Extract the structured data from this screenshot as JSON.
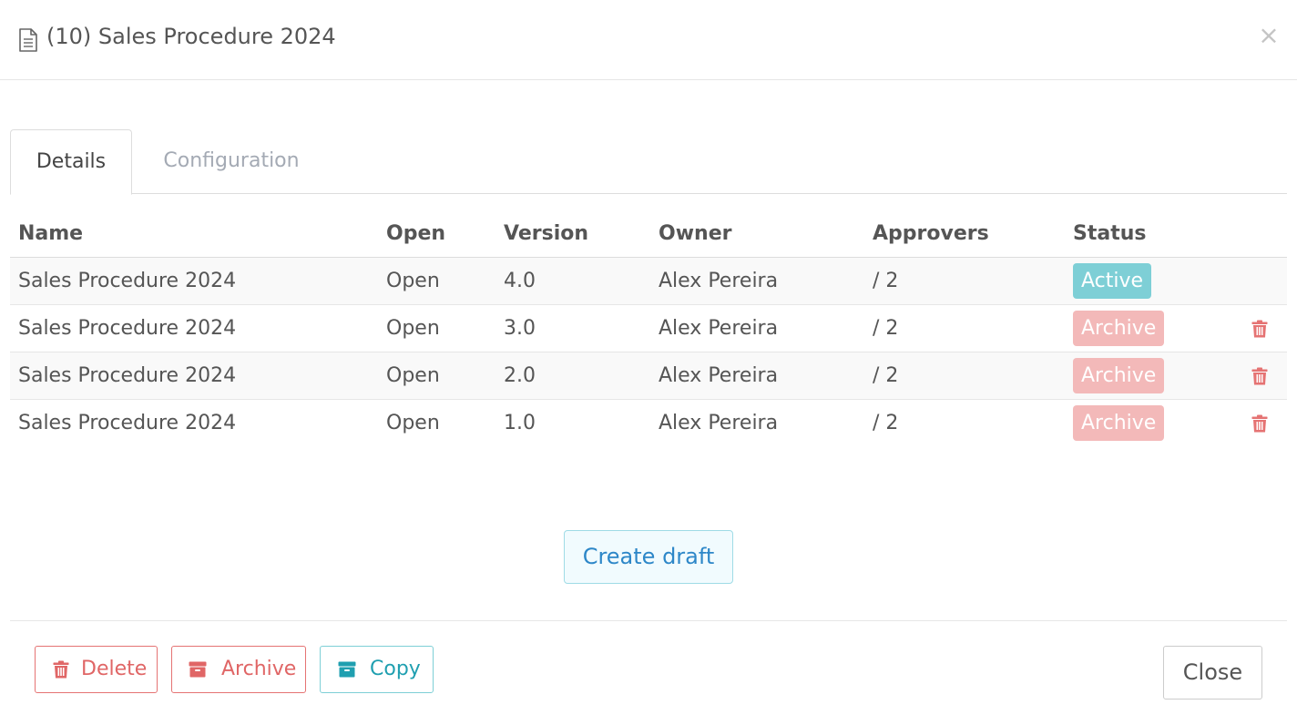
{
  "modal": {
    "title": "(10) Sales Procedure 2024",
    "close_symbol": "×"
  },
  "tabs": [
    {
      "label": "Details",
      "active": true
    },
    {
      "label": "Configuration",
      "active": false
    }
  ],
  "table": {
    "columns": [
      "Name",
      "Open",
      "Version",
      "Owner",
      "Approvers",
      "Status"
    ],
    "rows": [
      {
        "name": "Sales Procedure 2024",
        "open": "Open",
        "version": "4.0",
        "owner": "Alex Pereira",
        "approvers": "/ 2",
        "status": "Active",
        "deletable": false
      },
      {
        "name": "Sales Procedure 2024",
        "open": "Open",
        "version": "3.0",
        "owner": "Alex Pereira",
        "approvers": "/ 2",
        "status": "Archive",
        "deletable": true
      },
      {
        "name": "Sales Procedure 2024",
        "open": "Open",
        "version": "2.0",
        "owner": "Alex Pereira",
        "approvers": "/ 2",
        "status": "Archive",
        "deletable": true
      },
      {
        "name": "Sales Procedure 2024",
        "open": "Open",
        "version": "1.0",
        "owner": "Alex Pereira",
        "approvers": "/ 2",
        "status": "Archive",
        "deletable": true
      }
    ]
  },
  "create_draft_label": "Create draft",
  "footer": {
    "delete_label": "Delete",
    "archive_label": "Archive",
    "copy_label": "Copy",
    "close_label": "Close"
  },
  "icons": {
    "title": "document-icon",
    "close": "close-icon",
    "row_delete": "trash-icon",
    "delete": "trash-icon",
    "archive": "archive-box-icon",
    "copy": "archive-box-icon"
  },
  "colors": {
    "link": "#3fbfbf",
    "active_badge": "#7ecfd6",
    "archive_badge": "#f3b9b9",
    "danger": "#e06666",
    "create_draft_text": "#2d87c8"
  }
}
